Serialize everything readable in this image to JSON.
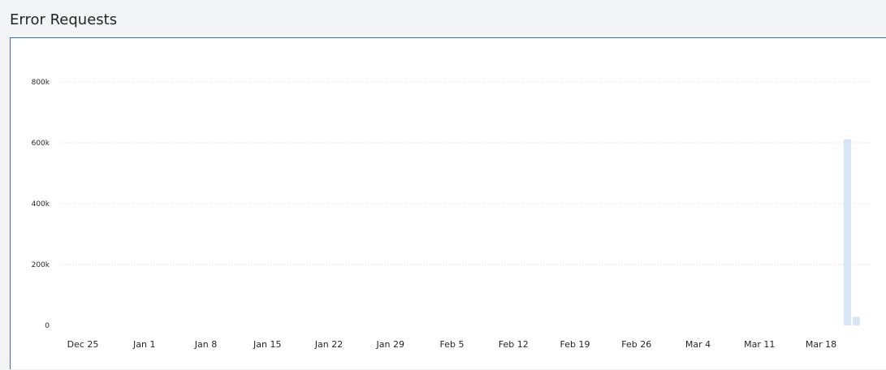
{
  "title": "Error Requests",
  "chart_data": {
    "type": "bar",
    "title": "Error Requests",
    "xlabel": "",
    "ylabel": "",
    "ylim": [
      0,
      900000
    ],
    "yticks": [
      0,
      200000,
      400000,
      600000,
      800000
    ],
    "ytick_labels": [
      "0",
      "200k",
      "400k",
      "600k",
      "800k"
    ],
    "x_tick_labels": [
      "Dec 25",
      "Jan 1",
      "Jan 8",
      "Jan 15",
      "Jan 22",
      "Jan 29",
      "Feb 5",
      "Feb 12",
      "Feb 19",
      "Feb 26",
      "Mar 4",
      "Mar 11",
      "Mar 18"
    ],
    "x_tick_dates": [
      "2023-12-25",
      "2024-01-01",
      "2024-01-08",
      "2024-01-15",
      "2024-01-22",
      "2024-01-29",
      "2024-02-05",
      "2024-02-12",
      "2024-02-19",
      "2024-02-26",
      "2024-03-04",
      "2024-03-11",
      "2024-03-18"
    ],
    "bars": [
      {
        "date": "2024-03-21",
        "value": 612000
      },
      {
        "date": "2024-03-22",
        "value": 28000
      }
    ],
    "grid": true,
    "bar_color": "#d6e6f6"
  }
}
